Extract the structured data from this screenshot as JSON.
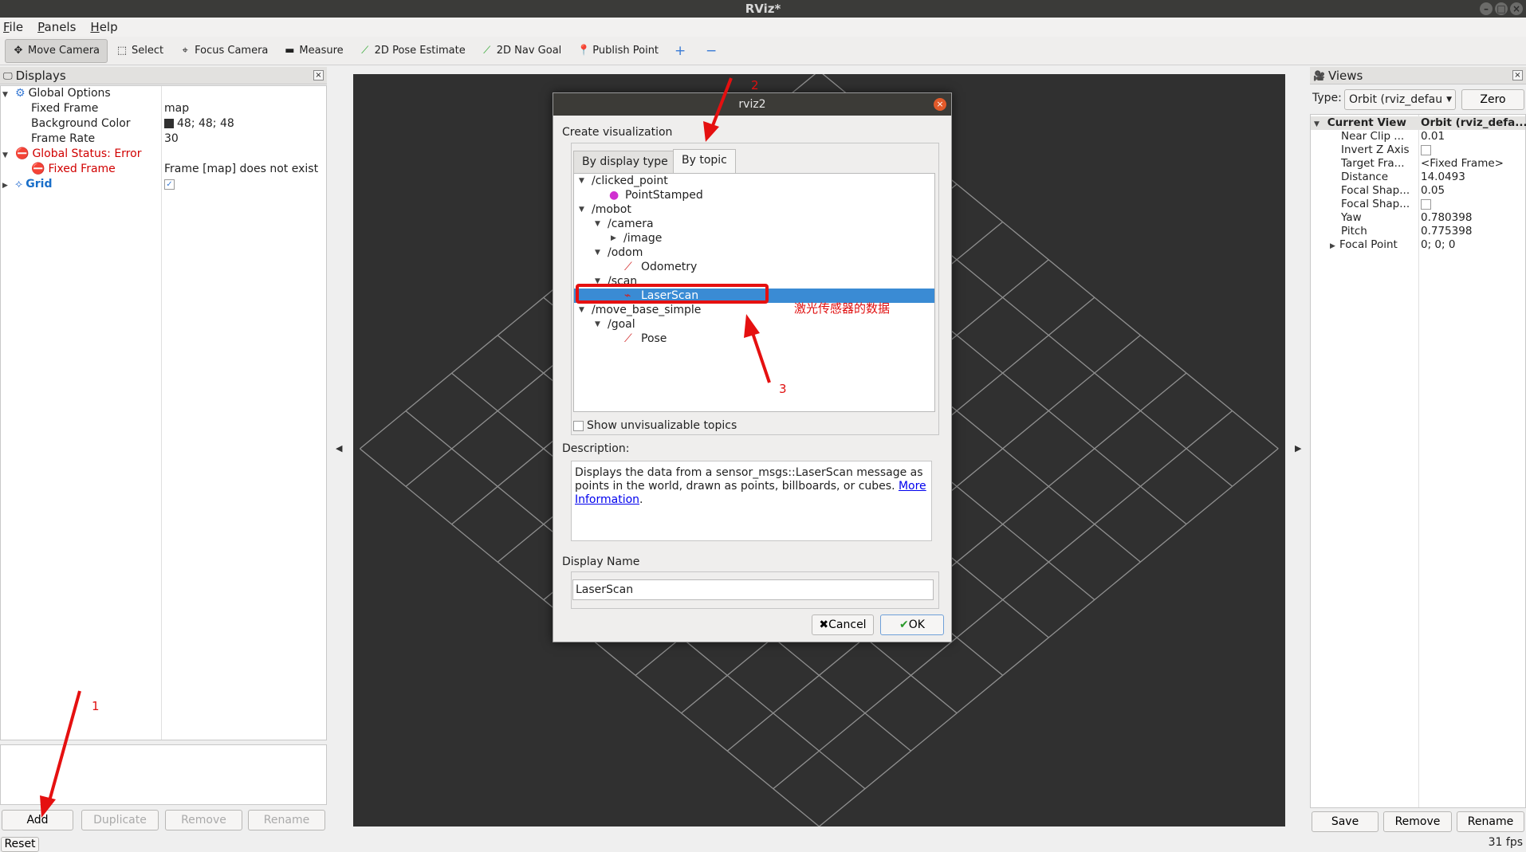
{
  "window": {
    "title": "RViz*"
  },
  "menu": [
    "File",
    "Panels",
    "Help"
  ],
  "toolbar": {
    "tools": [
      {
        "label": "Move Camera",
        "icon": "move-camera-icon"
      },
      {
        "label": "Select",
        "icon": "select-icon"
      },
      {
        "label": "Focus Camera",
        "icon": "focus-camera-icon"
      },
      {
        "label": "Measure",
        "icon": "measure-icon"
      },
      {
        "label": "2D Pose Estimate",
        "icon": "pose-estimate-icon"
      },
      {
        "label": "2D Nav Goal",
        "icon": "nav-goal-icon"
      },
      {
        "label": "Publish Point",
        "icon": "publish-point-icon"
      }
    ]
  },
  "displays": {
    "title": "Displays",
    "global_options": "Global Options",
    "fixed_frame_label": "Fixed Frame",
    "fixed_frame_value": "map",
    "bg_color_label": "Background Color",
    "bg_color_value": "48; 48; 48",
    "frame_rate_label": "Frame Rate",
    "frame_rate_value": "30",
    "global_status": "Global Status: Error",
    "fixed_frame_err": "Fixed Frame",
    "fixed_frame_err_msg": "Frame [map] does not exist",
    "grid": "Grid",
    "buttons": {
      "add": "Add",
      "duplicate": "Duplicate",
      "remove": "Remove",
      "rename": "Rename"
    },
    "reset": "Reset"
  },
  "views": {
    "title": "Views",
    "type_label": "Type:",
    "type_value": "Orbit (rviz_defau",
    "zero": "Zero",
    "header_col1": "Current View",
    "header_col2": "Orbit (rviz_defa...",
    "props": [
      {
        "k": "Near Clip ...",
        "v": "0.01"
      },
      {
        "k": "Invert Z Axis",
        "v": ""
      },
      {
        "k": "Target Fra...",
        "v": "<Fixed Frame>"
      },
      {
        "k": "Distance",
        "v": "14.0493"
      },
      {
        "k": "Focal Shap...",
        "v": "0.05"
      },
      {
        "k": "Focal Shap...",
        "v": ""
      },
      {
        "k": "Yaw",
        "v": "0.780398"
      },
      {
        "k": "Pitch",
        "v": "0.775398"
      },
      {
        "k": "Focal Point",
        "v": "0; 0; 0"
      }
    ],
    "buttons": {
      "save": "Save",
      "remove": "Remove",
      "rename": "Rename"
    }
  },
  "dialog": {
    "title": "rviz2",
    "create_label": "Create visualization",
    "tab_display_type": "By display type",
    "tab_by_topic": "By topic",
    "topics": [
      {
        "text": "/clicked_point",
        "indent": 0,
        "expand": "open"
      },
      {
        "text": "PointStamped",
        "indent": 2,
        "icon": "point-icon"
      },
      {
        "text": "/mobot",
        "indent": 0,
        "expand": "open"
      },
      {
        "text": "/camera",
        "indent": 1,
        "expand": "open"
      },
      {
        "text": "/image",
        "indent": 2,
        "expand": "closed"
      },
      {
        "text": "/odom",
        "indent": 1,
        "expand": "open"
      },
      {
        "text": "Odometry",
        "indent": 3,
        "icon": "odometry-icon"
      },
      {
        "text": "/scan",
        "indent": 1,
        "expand": "open"
      },
      {
        "text": "LaserScan",
        "indent": 3,
        "icon": "laserscan-icon",
        "selected": true
      },
      {
        "text": "/move_base_simple",
        "indent": 0,
        "expand": "open"
      },
      {
        "text": "/goal",
        "indent": 1,
        "expand": "open"
      },
      {
        "text": "Pose",
        "indent": 3,
        "icon": "pose-icon"
      }
    ],
    "show_unvisualizable": "Show unvisualizable topics",
    "description_label": "Description:",
    "description_text": "Displays the data from a sensor_msgs::LaserScan message as points in the world, drawn as points, billboards, or cubes. ",
    "more_info_link": "More Information",
    "description_end": ".",
    "display_name_label": "Display Name",
    "display_name_value": "LaserScan",
    "cancel": "Cancel",
    "ok": "OK"
  },
  "annotations": {
    "n1": "1",
    "n2": "2",
    "n3": "3",
    "laser_note": "激光传感器的数据"
  },
  "status": {
    "fps": "31 fps"
  }
}
